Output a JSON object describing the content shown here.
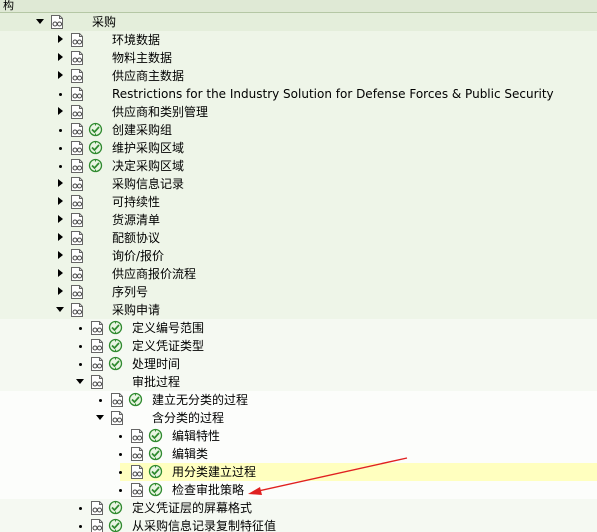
{
  "header": {
    "title": "构"
  },
  "tree": [
    {
      "label": "采购",
      "level": 0,
      "toggle": "expanded",
      "execute": false
    },
    {
      "label": "环境数据",
      "level": 1,
      "toggle": "collapsed",
      "execute": false
    },
    {
      "label": "物料主数据",
      "level": 1,
      "toggle": "collapsed",
      "execute": false
    },
    {
      "label": "供应商主数据",
      "level": 1,
      "toggle": "collapsed",
      "execute": false
    },
    {
      "label": "Restrictions for the Industry Solution for Defense Forces & Public Security",
      "level": 1,
      "toggle": "leaf",
      "execute": false
    },
    {
      "label": "供应商和类别管理",
      "level": 1,
      "toggle": "collapsed",
      "execute": false
    },
    {
      "label": "创建采购组",
      "level": 1,
      "toggle": "leaf",
      "execute": true
    },
    {
      "label": "维护采购区域",
      "level": 1,
      "toggle": "leaf",
      "execute": true
    },
    {
      "label": "决定采购区域",
      "level": 1,
      "toggle": "leaf",
      "execute": true
    },
    {
      "label": "采购信息记录",
      "level": 1,
      "toggle": "collapsed",
      "execute": false
    },
    {
      "label": "可持续性",
      "level": 1,
      "toggle": "collapsed",
      "execute": false
    },
    {
      "label": "货源清单",
      "level": 1,
      "toggle": "collapsed",
      "execute": false
    },
    {
      "label": "配额协议",
      "level": 1,
      "toggle": "collapsed",
      "execute": false
    },
    {
      "label": "询价/报价",
      "level": 1,
      "toggle": "collapsed",
      "execute": false
    },
    {
      "label": "供应商报价流程",
      "level": 1,
      "toggle": "collapsed",
      "execute": false
    },
    {
      "label": "序列号",
      "level": 1,
      "toggle": "collapsed",
      "execute": false
    },
    {
      "label": "采购申请",
      "level": 1,
      "toggle": "expanded",
      "execute": false
    },
    {
      "label": "定义编号范围",
      "level": 2,
      "toggle": "leaf",
      "execute": true
    },
    {
      "label": "定义凭证类型",
      "level": 2,
      "toggle": "leaf",
      "execute": true
    },
    {
      "label": "处理时间",
      "level": 2,
      "toggle": "leaf",
      "execute": true
    },
    {
      "label": "审批过程",
      "level": 2,
      "toggle": "expanded",
      "execute": false
    },
    {
      "label": "建立无分类的过程",
      "level": 3,
      "toggle": "leaf",
      "execute": true
    },
    {
      "label": "含分类的过程",
      "level": 3,
      "toggle": "expanded",
      "execute": false
    },
    {
      "label": "编辑特性",
      "level": 4,
      "toggle": "leaf",
      "execute": true
    },
    {
      "label": "编辑类",
      "level": 4,
      "toggle": "leaf",
      "execute": true
    },
    {
      "label": "用分类建立过程",
      "level": 4,
      "toggle": "leaf",
      "execute": true,
      "highlighted": true
    },
    {
      "label": "检查审批策略",
      "level": 4,
      "toggle": "leaf",
      "execute": true
    },
    {
      "label": "定义凭证层的屏幕格式",
      "level": 2,
      "toggle": "leaf",
      "execute": true
    },
    {
      "label": "从采购信息记录复制特征值",
      "level": 2,
      "toggle": "leaf",
      "execute": true
    }
  ],
  "colors": {
    "header_bg": "#dfe9d5",
    "level0_bg": "#e4eedb",
    "level1_bg": "#eef5e8",
    "level2_bg": "#f5f9f2",
    "level3_bg": "#fcfdfb",
    "highlight_bg": "#ffffbf",
    "annotation_arrow": "#e02020",
    "execute_icon": "#2f8a2f"
  },
  "icons": {
    "document": "documentation-icon",
    "execute": "execute-clock-icon",
    "expanded": "triangle-down-icon",
    "collapsed": "triangle-right-icon",
    "leaf": "bullet-dot-icon"
  },
  "annotation": {
    "type": "red-arrow",
    "points_to": "检查审批策略"
  }
}
